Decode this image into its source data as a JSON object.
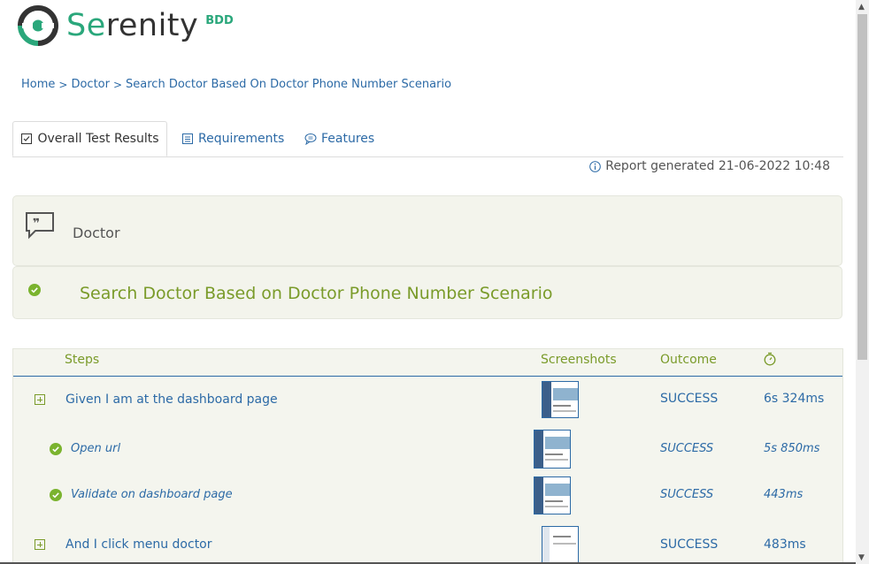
{
  "logo": {
    "brand_prefix": "Se",
    "brand_rest": "renity",
    "badge": "BDD"
  },
  "breadcrumb": {
    "items": [
      "Home",
      "Doctor",
      "Search Doctor Based On Doctor Phone Number Scenario"
    ],
    "separator": ">"
  },
  "tabs": [
    {
      "label": "Overall Test Results",
      "icon": "checklist-icon"
    },
    {
      "label": "Requirements",
      "icon": "list-icon"
    },
    {
      "label": "Features",
      "icon": "comments-icon"
    }
  ],
  "report_generated": "Report generated 21-06-2022 10:48",
  "feature": {
    "name": "Doctor"
  },
  "scenario": {
    "title": "Search Doctor Based on Doctor Phone Number Scenario",
    "status_icon": "success-check-icon"
  },
  "steps_table": {
    "headers": {
      "steps": "Steps",
      "screenshots": "Screenshots",
      "outcome": "Outcome",
      "duration_icon": "stopwatch-icon"
    },
    "rows": [
      {
        "step": "Given I am at the dashboard page",
        "outcome": "SUCCESS",
        "duration": "6s 324ms",
        "level": "top"
      },
      {
        "step": "Open url",
        "outcome": "SUCCESS",
        "duration": "5s 850ms",
        "level": "sub"
      },
      {
        "step": "Validate on dashboard page",
        "outcome": "SUCCESS",
        "duration": "443ms",
        "level": "sub"
      },
      {
        "step": "And I click menu doctor",
        "outcome": "SUCCESS",
        "duration": "483ms",
        "level": "top"
      }
    ]
  },
  "colors": {
    "brand_green": "#2aa77b",
    "link_blue": "#2c6aa6",
    "success_green": "#7a9b2a",
    "panel_bg": "#f3f4ec"
  }
}
